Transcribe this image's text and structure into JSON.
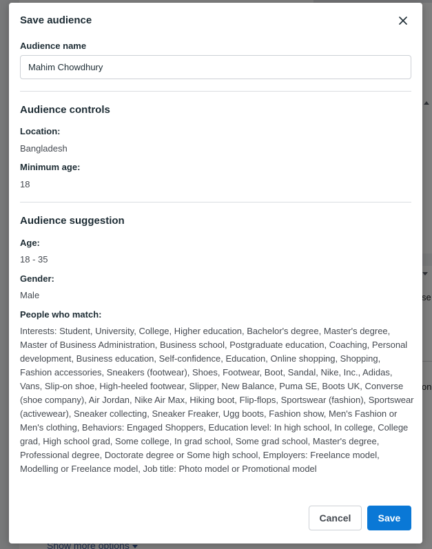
{
  "dialog": {
    "title": "Save audience",
    "close_icon": "close-icon"
  },
  "audience_name": {
    "label": "Audience name",
    "value": "Mahim Chowdhury"
  },
  "audience_controls": {
    "title": "Audience controls",
    "location_label": "Location:",
    "location_value": "Bangladesh",
    "min_age_label": "Minimum age:",
    "min_age_value": "18"
  },
  "audience_suggestion": {
    "title": "Audience suggestion",
    "age_label": "Age:",
    "age_value": "18 - 35",
    "gender_label": "Gender:",
    "gender_value": "Male",
    "people_label": "People who match:",
    "people_value": "Interests: Student, University, College, Higher education, Bachelor's degree, Master's degree, Master of Business Administration, Business school, Postgraduate education, Coaching, Personal development, Business education, Self-confidence, Education, Online shopping, Shopping, Fashion accessories, Sneakers (footwear), Shoes, Footwear, Boot, Sandal, Nike, Inc., Adidas, Vans, Slip-on shoe, High-heeled footwear, Slipper, New Balance, Puma SE, Boots UK, Converse (shoe company), Air Jordan, Nike Air Max, Hiking boot, Flip-flops, Sportswear (fashion), Sportswear (activewear), Sneaker collecting, Sneaker Freaker, Ugg boots, Fashion show, Men's Fashion or Men's clothing, Behaviors: Engaged Shoppers, Education level: In high school, In college, College grad, High school grad, Some college, In grad school, Some grad school, Master's degree, Professional degree, Doctorate degree or Some high school, Employers: Freelance model, Modelling or Freelance model, Job title: Photo model or Promotional model"
  },
  "actions": {
    "cancel_label": "Cancel",
    "save_label": "Save"
  },
  "background": {
    "show_more_label": "Show more options",
    "frag_se": "se",
    "frag_on": "on"
  },
  "colors": {
    "primary": "#0a78d6",
    "text": "#1c2b33",
    "muted": "#444950",
    "divider": "#dadde1"
  }
}
